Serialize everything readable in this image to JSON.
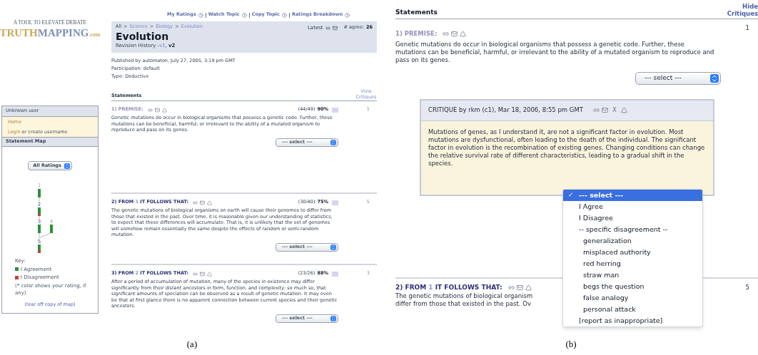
{
  "figure_a": {
    "logo": {
      "tagline": "A TOOL TO ELEVATE DEBATE",
      "first": "TRUTH",
      "second": "MAPPING",
      "suffix": ".com"
    },
    "sidebar": {
      "user_title": "Unknown user",
      "home_link": "Home",
      "login_link": "Login",
      "login_rest": " or create username",
      "map_title": "Statement Map",
      "map_filter": "All Ratings",
      "map_nodes": [
        {
          "label": "1"
        },
        {
          "label": "2"
        },
        {
          "label": "3"
        },
        {
          "label": "4"
        },
        {
          "label": "5"
        }
      ],
      "key_title": "Key:",
      "key_items": [
        {
          "label": "I Agreement",
          "color": "#2f8f3a"
        },
        {
          "label": "I Disagreement",
          "color": "#c8402e"
        }
      ],
      "key_note": "(* color shows your rating, if any)",
      "tear_off_link": "(tear off copy of map)"
    },
    "top_links": [
      {
        "label": "My Ratings"
      },
      {
        "label": "Watch Topic"
      },
      {
        "label": "Copy Topic"
      },
      {
        "label": "Ratings Breakdown"
      }
    ],
    "header": {
      "breadcrumb": [
        "All",
        "Science",
        "Biology",
        "Evolution"
      ],
      "breadcrumb_separator": ">",
      "revision_separator": ",",
      "title": "Evolution",
      "revision_label": "Revision History - ",
      "revisions": [
        {
          "label": "v1",
          "selected": false
        },
        {
          "label": "v2",
          "selected": true
        }
      ],
      "latest": "Latest",
      "agree_label": "# agree:",
      "agree_count": "26"
    },
    "meta": [
      "Published by automaton, July 27, 2005, 3:19 pm GMT",
      "Participation: default",
      "Type: Deductive"
    ],
    "statements_title": "Statements",
    "critiques_link": "View Critiques",
    "statements": [
      {
        "kind": "premise",
        "label": "1) PREMISE:",
        "score": "(44/49)",
        "percent": "90%",
        "critiques": "1",
        "text": "Genetic mutations do occur in biological organisms that possess a genetic code. Further, these mutations can be beneficial, harmful, or irrelevant to the ability of a mutated organism to reproduce and pass on its genes.",
        "select": "--- select ---"
      },
      {
        "kind": "derived",
        "label_start": "2) FROM ",
        "ref": "1",
        "label_end": " IT FOLLOWS THAT:",
        "score": "(30/40)",
        "percent": "75%",
        "critiques": "5",
        "text": "The genetic mutations of biological organisms on earth will cause their genomes to differ from those that existed in the past. Over time, it is reasonable given our understanding of statistics, to expect that these differences will accumulate. That is, it is unlikely that the set of genomes will somehow remain essentially the same despite the effects of random or semi-random mutation.",
        "select": "--- select ---"
      },
      {
        "kind": "derived",
        "label_start": "3) FROM ",
        "ref": "2",
        "label_end": " IT FOLLOWS THAT:",
        "score": "(23/26)",
        "percent": "88%",
        "critiques": "3",
        "text": "After a period of accumulation of mutation, many of the species in existence may differ significantly from their distant ancestors in form, function, and complexity; so much so, that significant amounts of speciation can be observed as a result of genetic mutation. It may even be that at first glance there is no apparent connection between current species and their genetic ancestors.",
        "select": "--- select ---"
      }
    ],
    "caption": "(a)"
  },
  "figure_b": {
    "statements_title": "Statements",
    "critiques_link": "Hide Critiques",
    "statement": {
      "label": "1) PREMISE:",
      "critiques": "1",
      "text": "Genetic mutations do occur in biological organisms that possess a genetic code. Further, these mutations can be beneficial, harmful, or irrelevant to the ability of a mutated organism to reproduce and pass on its genes.",
      "select": "--- select ---"
    },
    "critique": {
      "header": "CRITIQUE by rkm (c1), Mar 18, 2006, 8:55 pm GMT",
      "close": "X",
      "text": "Mutations of genes, as I understand it, are not a significant factor in evolution. Most mutations are dysfunctional, often leading to the death of the individual. The significant factor in evolution is the recombination of existing genes. Changing conditions can change the relative survival rate of different characteristics, leading to a gradual shift in the species."
    },
    "check_mark": "✓",
    "dropdown": [
      {
        "label": "--- select ---",
        "selected": true
      },
      {
        "label": "I Agree",
        "selected": false
      },
      {
        "label": "I Disagree",
        "selected": false
      },
      {
        "label": "-- specific disagreement --",
        "selected": false,
        "children": [
          {
            "label": "generalization",
            "selected": false
          },
          {
            "label": "misplaced authority",
            "selected": false
          },
          {
            "label": "red herring",
            "selected": false
          },
          {
            "label": "straw man",
            "selected": false
          },
          {
            "label": "begs the question",
            "selected": false
          },
          {
            "label": "false analogy",
            "selected": false
          },
          {
            "label": "personal attack",
            "selected": false
          }
        ]
      },
      {
        "label": "[report as inappropriate]",
        "selected": false
      }
    ],
    "next_statement": {
      "label_start": "2) FROM ",
      "ref": "1",
      "label_end": " IT FOLLOWS THAT:",
      "critiques": "5",
      "lines": [
        "The genetic mutations of biological organism",
        "differ from those that existed in the past. Ov"
      ]
    },
    "caption": "(b)"
  }
}
